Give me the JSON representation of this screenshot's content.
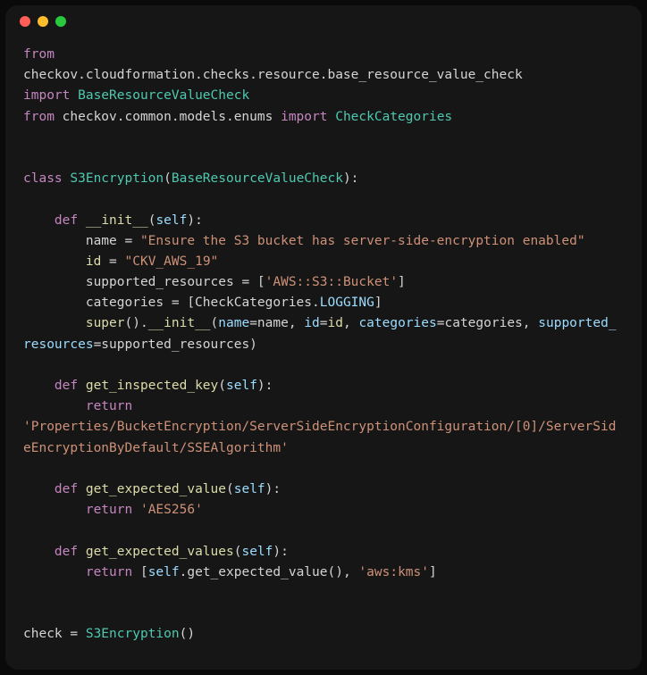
{
  "colors": {
    "bg": "#161616",
    "red": "#ff5f56",
    "yellow": "#ffbd2e",
    "green": "#27c93f"
  },
  "code": {
    "l1_from": "from",
    "l1_mod": " \ncheckov.cloudformation.checks.resource.base_resource_value_check ",
    "l1_import": "\nimport",
    "l1_cls": " BaseResourceValueCheck",
    "l2_from": "from",
    "l2_mod": " checkov.common.models.enums ",
    "l2_import": "import",
    "l2_cls": " CheckCategories",
    "blank1": "\n\n\n",
    "l3_class": "class",
    "l3_name": " S3Encryption",
    "l3_open": "(",
    "l3_base": "BaseResourceValueCheck",
    "l3_close": "):",
    "l4_indent": "\n\n    ",
    "l4_def": "def",
    "l4_fn": " __init__",
    "l4_open": "(",
    "l4_self": "self",
    "l4_close": "):",
    "l5_indent": "\n        ",
    "l5_var": "name = ",
    "l5_str": "\"Ensure the S3 bucket has server-side-encryption enabled\"",
    "l6_indent": "\n        ",
    "l6_var": "id",
    "l6_eq": " = ",
    "l6_str": "\"CKV_AWS_19\"",
    "l7_indent": "\n        ",
    "l7_var": "supported_resources = [",
    "l7_str": "'AWS::S3::Bucket'",
    "l7_close": "]",
    "l8_indent": "\n        ",
    "l8_var": "categories = [CheckCategories.",
    "l8_const": "LOGGING",
    "l8_close": "]",
    "l9_indent": "\n        ",
    "l9_super": "super",
    "l9_call": "().",
    "l9_fn": "__init__",
    "l9_args": "(",
    "l9_p1": "name",
    "l9_eq1": "=name, ",
    "l9_p2": "id",
    "l9_eq2": "=",
    "l9_id": "id",
    "l9_c2": ", ",
    "l9_p3": "categories",
    "l9_eq3": "=categories, ",
    "l9_p4": "supported_resources",
    "l9_eq4": "=supported_resources)",
    "l10_indent": "\n\n    ",
    "l10_def": "def",
    "l10_fn": " get_inspected_key",
    "l10_open": "(",
    "l10_self": "self",
    "l10_close": "):",
    "l11_indent": "\n        ",
    "l11_return": "return",
    "l11_str": " \n'Properties/BucketEncryption/ServerSideEncryptionConfiguration/[0]/ServerSideEncryptionByDefault/SSEAlgorithm'",
    "l12_indent": "\n\n    ",
    "l12_def": "def",
    "l12_fn": " get_expected_value",
    "l12_open": "(",
    "l12_self": "self",
    "l12_close": "):",
    "l13_indent": "\n        ",
    "l13_return": "return",
    "l13_str": " 'AES256'",
    "l14_indent": "\n\n    ",
    "l14_def": "def",
    "l14_fn": " get_expected_values",
    "l14_open": "(",
    "l14_self": "self",
    "l14_close": "):",
    "l15_indent": "\n        ",
    "l15_return": "return",
    "l15_open": " [",
    "l15_self": "self",
    "l15_call": ".get_expected_value(), ",
    "l15_str": "'aws:kms'",
    "l15_close": "]",
    "l16_indent": "\n\n\n",
    "l16_var": "check = ",
    "l16_fn": "S3Encryption",
    "l16_call": "()"
  }
}
